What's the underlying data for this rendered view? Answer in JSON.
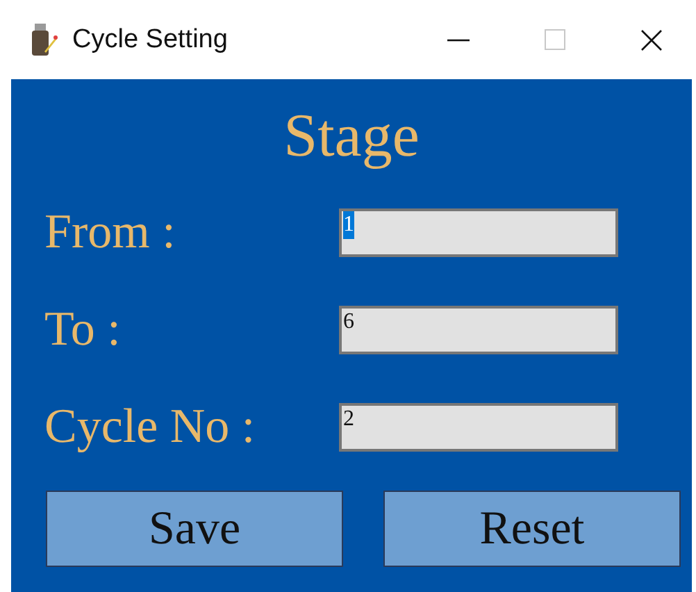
{
  "window": {
    "title": "Cycle Setting",
    "maximize_disabled": true
  },
  "heading": "Stage",
  "fields": [
    {
      "label": "From :",
      "value": "1",
      "text_selected": true
    },
    {
      "label": "To :",
      "value": "6",
      "text_selected": false
    },
    {
      "label": "Cycle No :",
      "value": "2",
      "text_selected": false
    }
  ],
  "buttons": [
    "Save",
    "Reset"
  ]
}
